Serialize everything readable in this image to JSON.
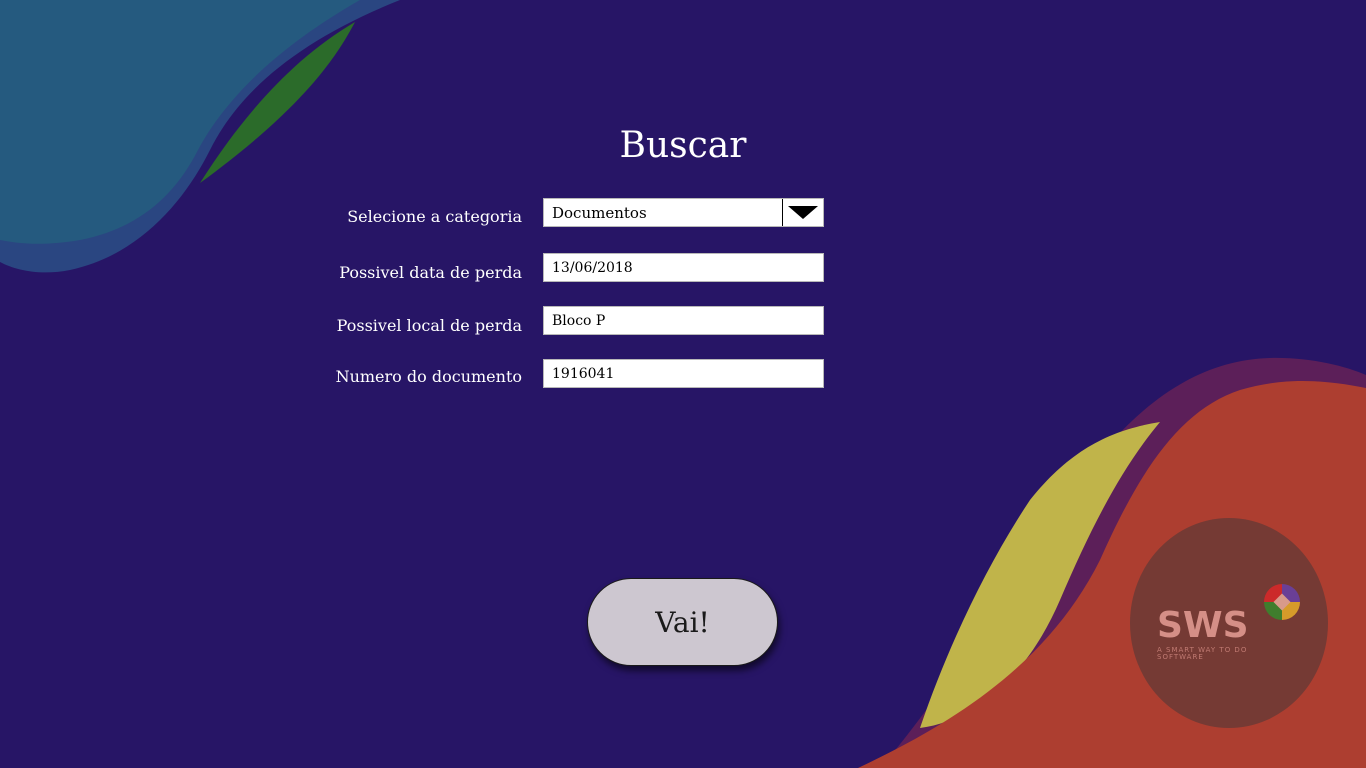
{
  "form": {
    "title": "Buscar",
    "category_label": "Selecione a categoria",
    "category_value": "Documentos",
    "date_label": "Possivel data de perda",
    "date_value": "13/06/2018",
    "place_label": "Possivel local de perda",
    "place_value": "Bloco P",
    "doc_number_label": "Numero do documento",
    "doc_number_value": "1916041",
    "submit_label": "Vai!"
  },
  "logo": {
    "name": "SWS",
    "tagline": "A SMART WAY TO DO SOFTWARE",
    "icon": "four-color-circle-icon"
  },
  "colors": {
    "background": "#271566",
    "blob_top_left": "#255a7f",
    "accent_green": "#2b6b2a",
    "blob_yellow": "#c0b44a",
    "blob_purple": "#5c1f59",
    "blob_red": "#ad3e30",
    "button_fill": "#cdc7d0"
  }
}
